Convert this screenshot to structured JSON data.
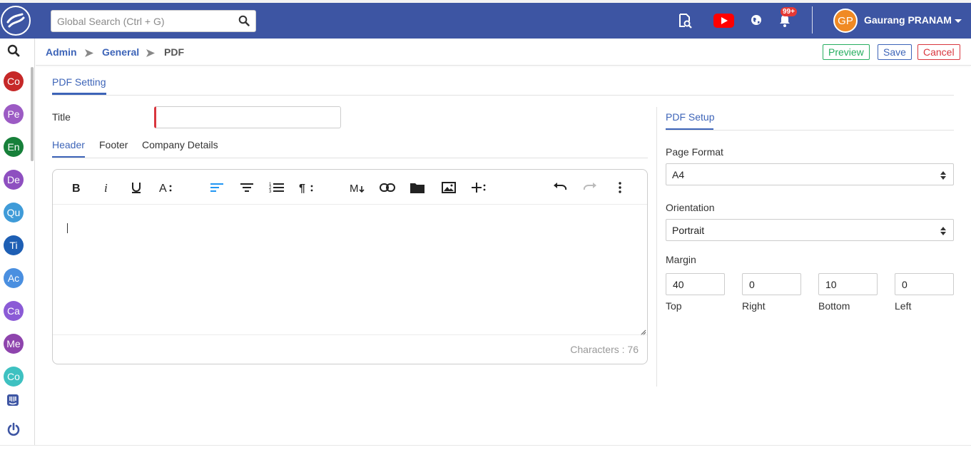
{
  "search": {
    "placeholder": "Global Search (Ctrl + G)"
  },
  "header": {
    "notification_badge": "99+",
    "user": {
      "initials": "GP",
      "name": "Gaurang PRANAM"
    }
  },
  "sidebar": {
    "modules": [
      {
        "label": "Co",
        "color": "#c62828"
      },
      {
        "label": "Pe",
        "color": "#9c5bc4"
      },
      {
        "label": "En",
        "color": "#17803a"
      },
      {
        "label": "De",
        "color": "#8e4fc0"
      },
      {
        "label": "Qu",
        "color": "#3f9bd8"
      },
      {
        "label": "Ti",
        "color": "#1e5fb4"
      },
      {
        "label": "Ac",
        "color": "#4a8fe0"
      },
      {
        "label": "Ca",
        "color": "#8b5bd6"
      },
      {
        "label": "Me",
        "color": "#8e44ad"
      },
      {
        "label": "Co",
        "color": "#3ec1c1"
      }
    ]
  },
  "breadcrumb": {
    "items": [
      "Admin",
      "General",
      "PDF"
    ]
  },
  "actions": {
    "preview": "Preview",
    "save": "Save",
    "cancel": "Cancel"
  },
  "main": {
    "tab": "PDF Setting",
    "title_label": "Title",
    "title_value": "",
    "editor_tabs": [
      "Header",
      "Footer",
      "Company Details"
    ],
    "char_count": "Characters : 76"
  },
  "pdf_setup": {
    "tab": "PDF Setup",
    "page_format_label": "Page Format",
    "page_format_value": "A4",
    "orientation_label": "Orientation",
    "orientation_value": "Portrait",
    "margin_label": "Margin",
    "margins": [
      {
        "label": "Top",
        "value": "40"
      },
      {
        "label": "Right",
        "value": "0"
      },
      {
        "label": "Bottom",
        "value": "10"
      },
      {
        "label": "Left",
        "value": "0"
      }
    ]
  },
  "colors": {
    "primary": "#3d55a3",
    "accent": "#3d64b8",
    "success": "#27ae60",
    "danger": "#d9363e"
  },
  "icons": [
    "search-icon",
    "doc-search-icon",
    "youtube-icon",
    "globe-icon",
    "bell-icon",
    "chevron-down-icon",
    "intercom-icon",
    "power-icon"
  ]
}
